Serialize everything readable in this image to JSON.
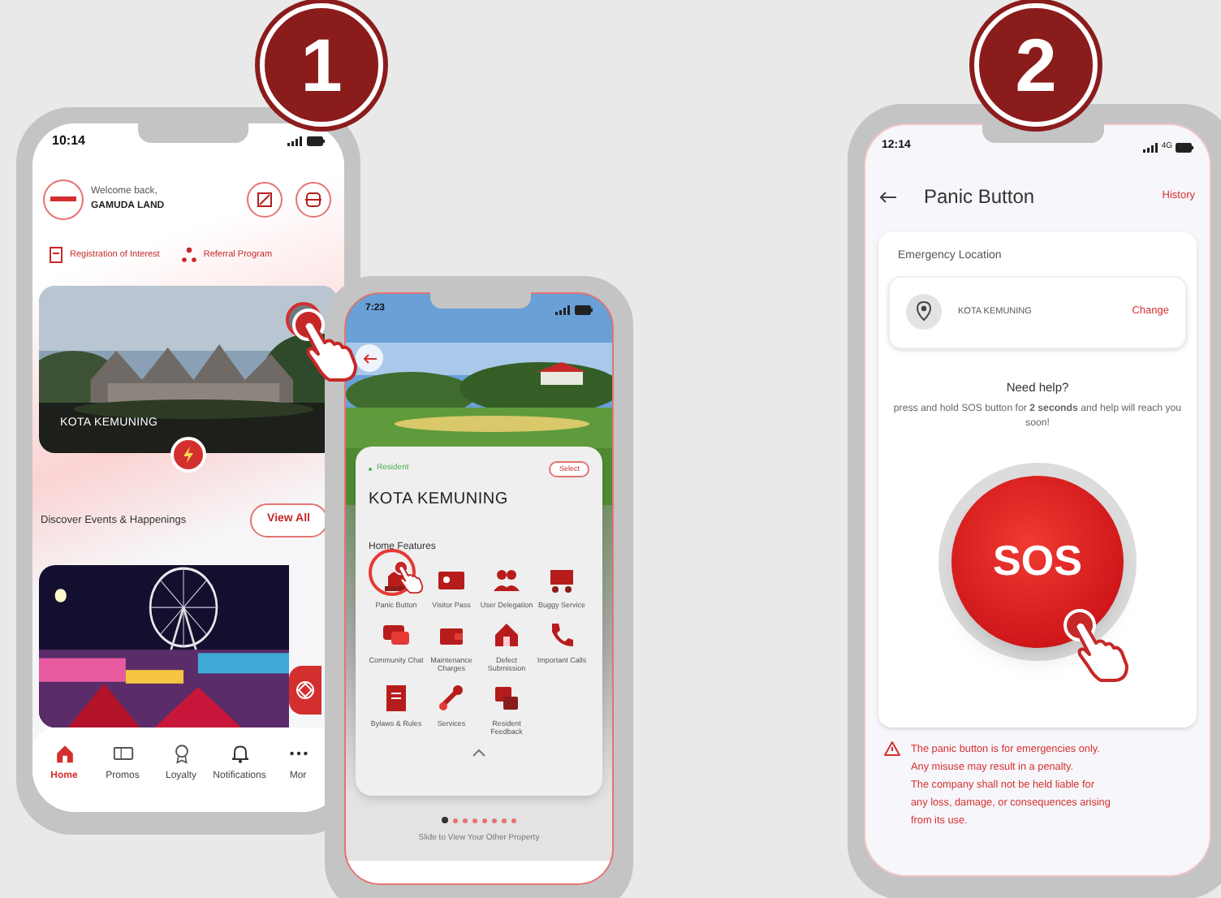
{
  "step_badges": [
    {
      "number": "1"
    },
    {
      "number": "2"
    }
  ],
  "home_screen": {
    "status_time": "10:14",
    "greeting": "Welcome back,",
    "user_name": "GAMUDA LAND",
    "quick_links": [
      "Registration of Interest",
      "Referral Program"
    ],
    "property_name": "KOTA KEMUNING",
    "events_heading": "Discover Events & Happenings",
    "view_all": "View All",
    "nav": [
      {
        "label": "Home",
        "selected": true
      },
      {
        "label": "Promos",
        "selected": false
      },
      {
        "label": "Loyalty",
        "selected": false
      },
      {
        "label": "Notifications",
        "selected": false
      },
      {
        "label": "Mor",
        "selected": false
      }
    ]
  },
  "property_screen": {
    "status_time": "7:23",
    "role": "Resident",
    "select": "Select",
    "property_name": "KOTA KEMUNING",
    "features_heading": "Home Features",
    "features": [
      "Panic Button",
      "Visitor Pass",
      "User Delegation",
      "Buggy Service",
      "Community Chat",
      "Maintenance Charges",
      "Defect Submission",
      "Important Calls",
      "Bylaws & Rules",
      "Services",
      "Resident Feedback"
    ],
    "pager": [
      {
        "selected": true
      },
      {
        "selected": false
      },
      {
        "selected": false
      },
      {
        "selected": false
      },
      {
        "selected": false
      },
      {
        "selected": false
      },
      {
        "selected": false
      },
      {
        "selected": false
      }
    ],
    "hint": "Slide to View Your Other Property"
  },
  "panic_screen": {
    "status_time": "12:14",
    "network": "4G",
    "title": "Panic Button",
    "history": "History",
    "location_heading": "Emergency Location",
    "location": "KOTA KEMUNING",
    "change": "Change",
    "help_title": "Need help?",
    "help_text": "press and hold SOS button for **2 seconds** and help will reach you soon!",
    "sos": "SOS",
    "disclaimer": [
      "The panic button is for emergencies only.",
      "Any misuse may result in a penalty.",
      "The company shall not be held liable for",
      "any loss, damage, or consequences arising",
      "from its use."
    ]
  }
}
